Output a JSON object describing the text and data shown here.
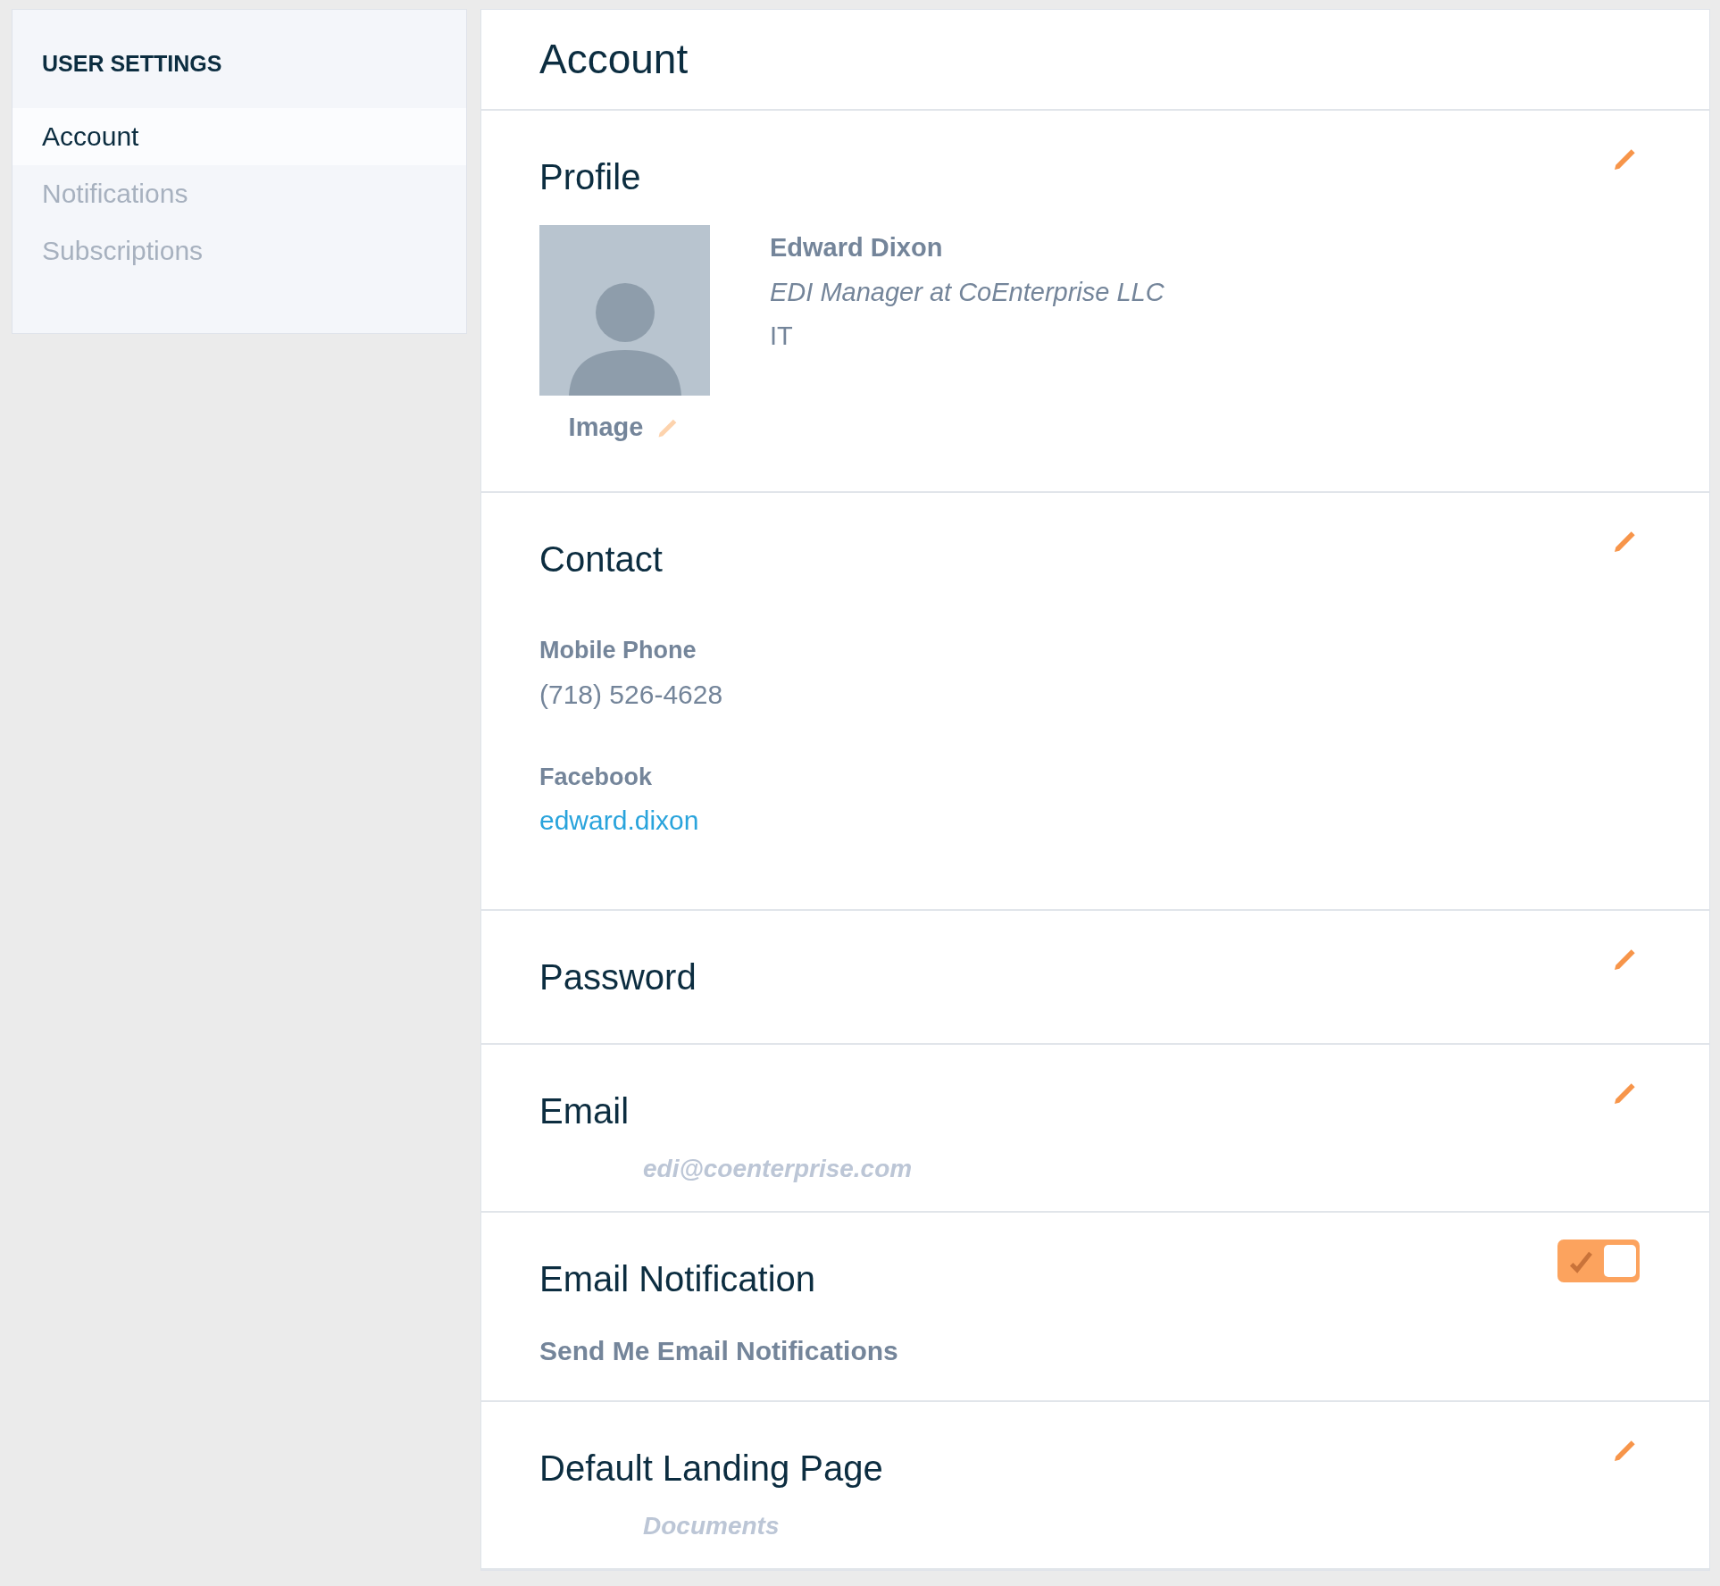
{
  "sidebar": {
    "title": "USER SETTINGS",
    "items": [
      {
        "label": "Account",
        "selected": true
      },
      {
        "label": "Notifications",
        "selected": false
      },
      {
        "label": "Subscriptions",
        "selected": false
      }
    ]
  },
  "page_title": "Account",
  "sections": [
    {
      "kind": "profile",
      "title": "Profile",
      "editable": true,
      "image_label": "Image",
      "name": "Edward Dixon",
      "job_title": "EDI Manager at CoEnterprise LLC",
      "department": "IT"
    },
    {
      "kind": "contact",
      "title": "Contact",
      "editable": true,
      "fields": [
        {
          "kind": "text",
          "label": "Mobile Phone",
          "value": "(718) 526-4628"
        },
        {
          "kind": "link",
          "label": "Facebook",
          "value": "edward.dixon"
        }
      ]
    },
    {
      "kind": "plain",
      "title": "Password",
      "editable": true
    },
    {
      "kind": "value",
      "title": "Email",
      "editable": true,
      "value": "edi@coenterprise.com"
    },
    {
      "kind": "toggle",
      "title": "Email Notification",
      "label": "Send Me Email Notifications",
      "on": true
    },
    {
      "kind": "value",
      "title": "Default Landing Page",
      "editable": true,
      "value": "Documents"
    }
  ]
}
